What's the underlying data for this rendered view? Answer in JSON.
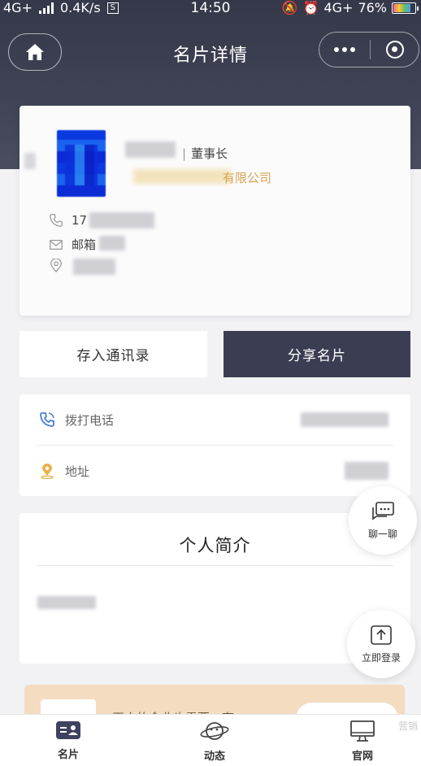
{
  "status_bar": {
    "network_left": "4G+",
    "speed": "0.4K/s",
    "time": "14:50",
    "network_right": "4G+",
    "battery": "76%",
    "battery_level": 0.76
  },
  "header": {
    "title": "名片详情"
  },
  "card": {
    "title_role": "董事长",
    "company_suffix": "有限公司",
    "phone_prefix": "17",
    "email_prefix": "邮箱"
  },
  "actions": {
    "save_contact": "存入通讯录",
    "share_card": "分享名片"
  },
  "info": {
    "call_label": "拨打电话",
    "address_label": "地址"
  },
  "intro": {
    "title": "个人简介"
  },
  "fabs": {
    "chat": "聊一聊",
    "login": "立即登录"
  },
  "promo": {
    "text": "再小的企业也需要一套"
  },
  "tabbar": {
    "tabs": [
      {
        "label": "名片",
        "icon": "card-icon"
      },
      {
        "label": "动态",
        "icon": "planet-icon"
      },
      {
        "label": "官网",
        "icon": "monitor-icon"
      }
    ]
  },
  "watermark": "营销"
}
